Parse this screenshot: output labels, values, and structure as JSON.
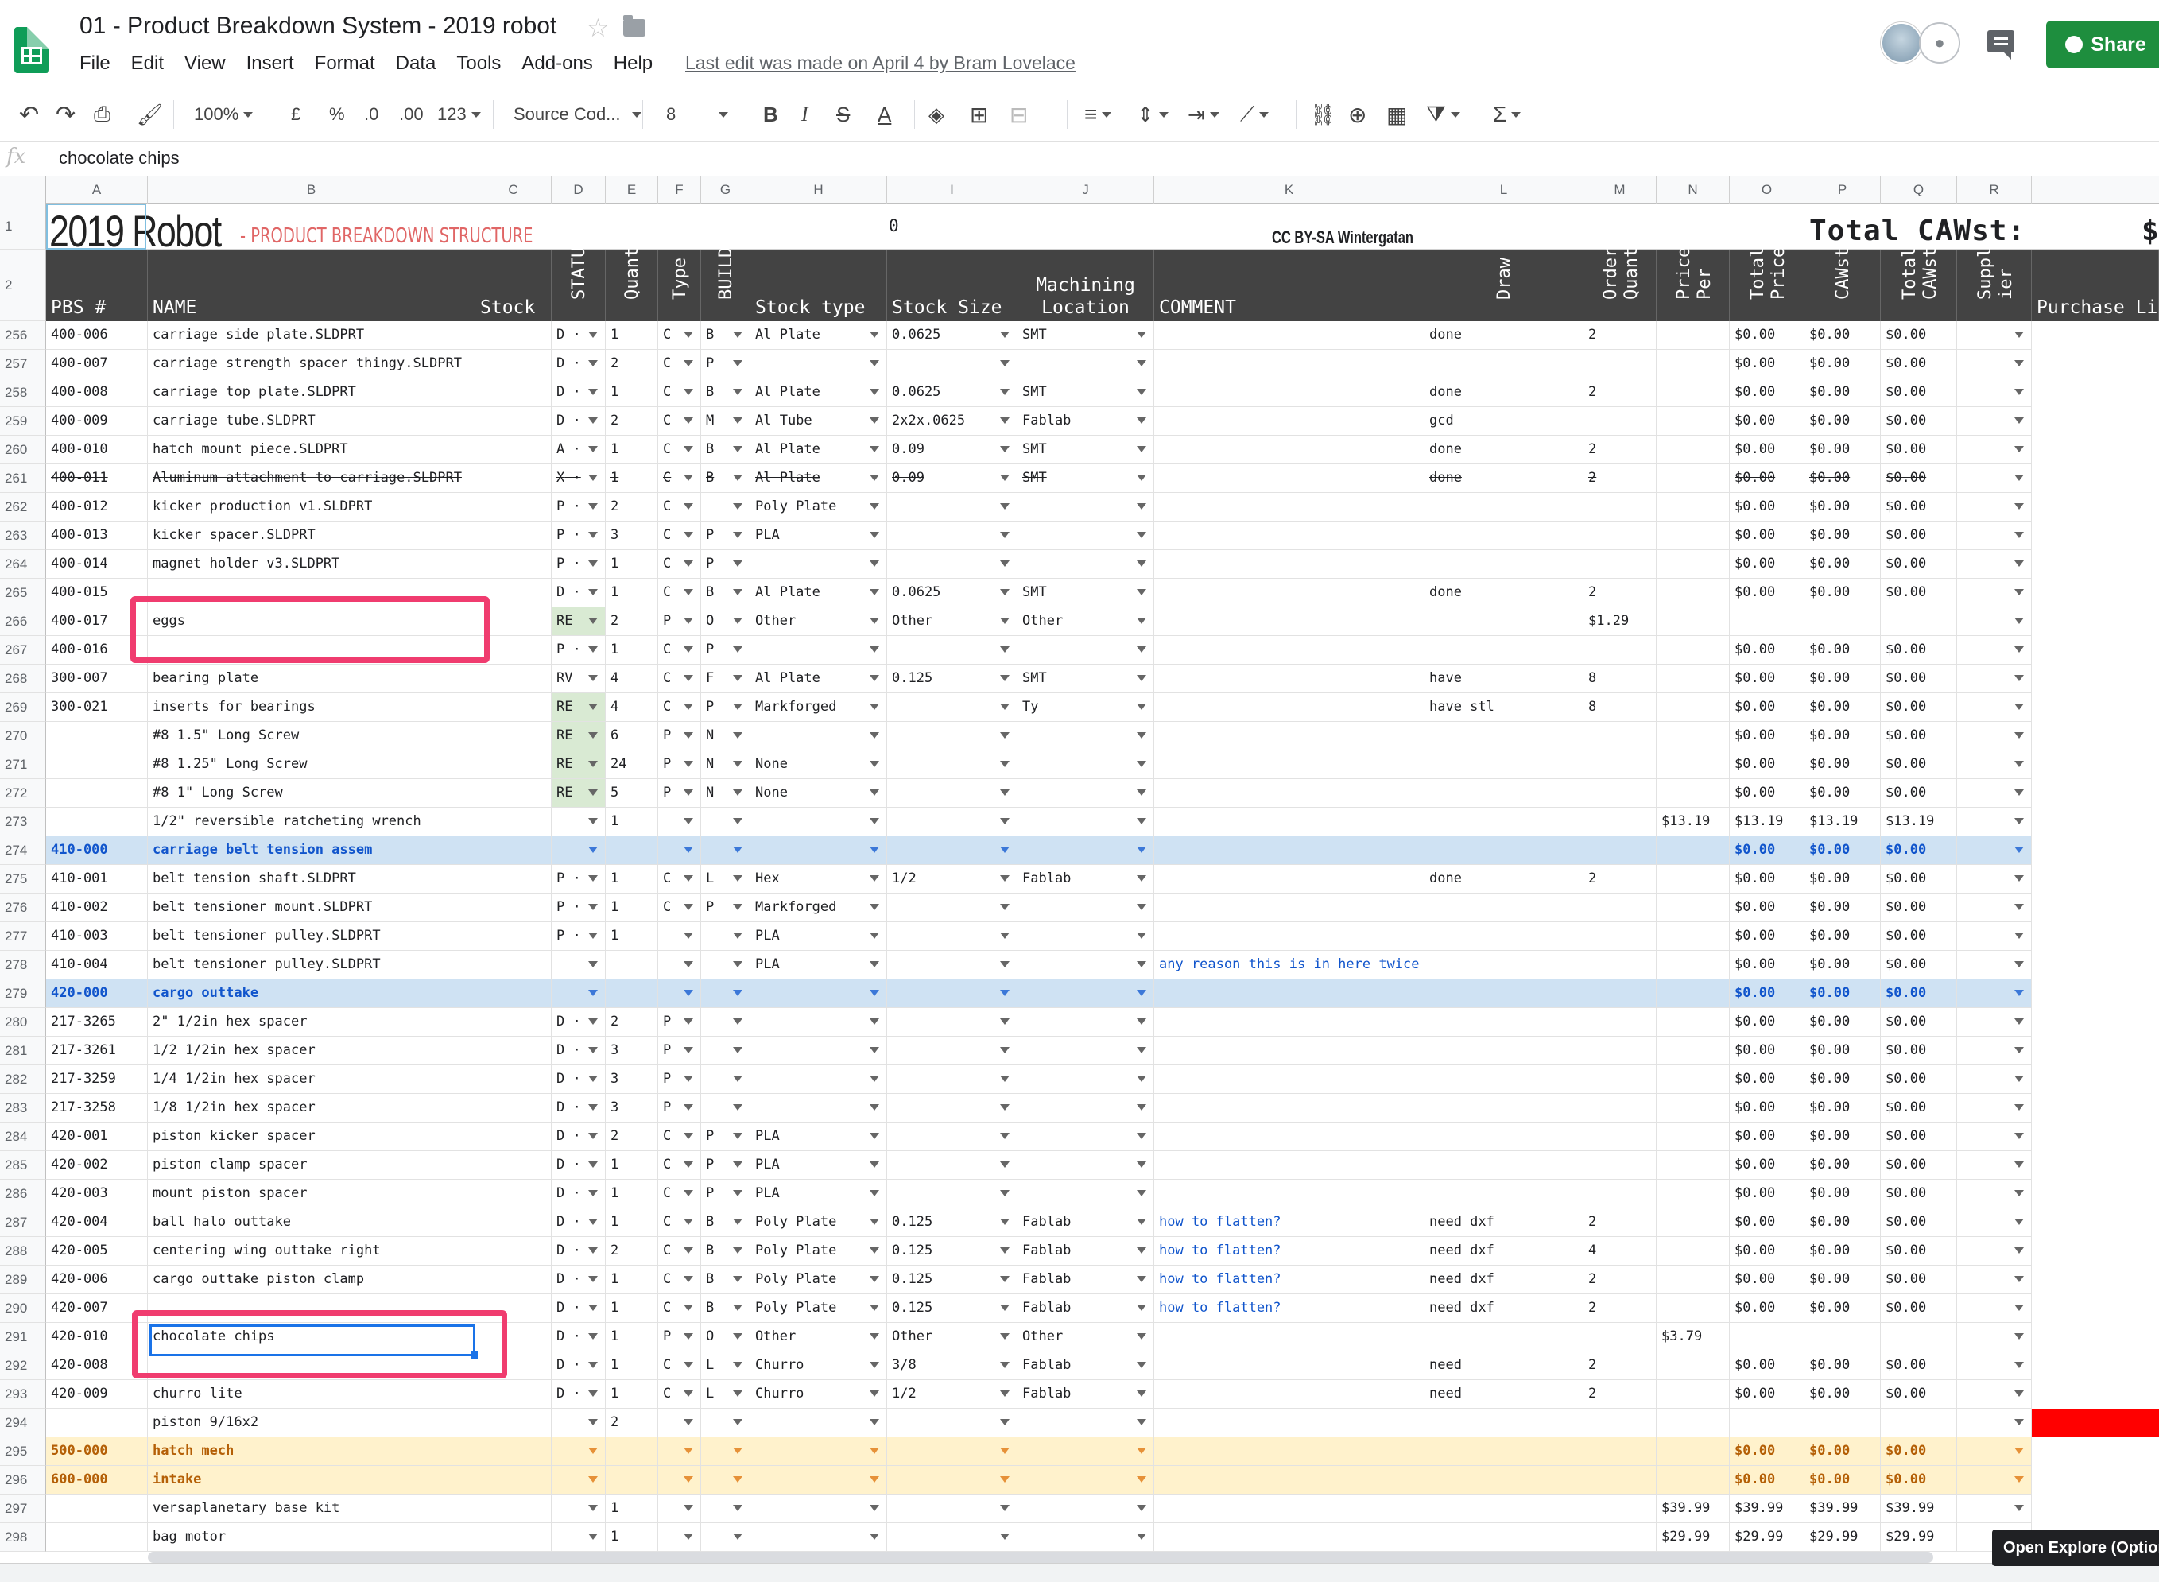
{
  "doc": {
    "title": "01 - Product Breakdown System - 2019 robot",
    "last_edit": "Last edit was made on April 4 by Bram Lovelace",
    "share_label": "Share"
  },
  "menu": [
    "File",
    "Edit",
    "View",
    "Insert",
    "Format",
    "Data",
    "Tools",
    "Add-ons",
    "Help"
  ],
  "toolbar": {
    "zoom": "100%",
    "currency": "£",
    "percent": "%",
    "dec_less": ".0",
    "dec_more": ".00",
    "format_more": "123",
    "font": "Source Cod...",
    "font_size": "8"
  },
  "formula": {
    "value": "chocolate chips"
  },
  "columns": [
    "A",
    "B",
    "C",
    "D",
    "E",
    "F",
    "G",
    "H",
    "I",
    "J",
    "K",
    "L",
    "M",
    "N",
    "O",
    "P",
    "Q",
    "R"
  ],
  "header_row1": {
    "row": "1",
    "title_big": "2019 Robot",
    "title_sub": "- PRODUCT BREAKDOWN STRUCTURE",
    "zero": "0",
    "cc": "CC BY-SA Wintergatan",
    "total": "Total CAWst:",
    "dollar": "$"
  },
  "header_row2": {
    "row": "2",
    "pbs": "PBS #",
    "name": "NAME",
    "stock": "Stock",
    "status": "STATUS",
    "quant": "Quant",
    "type": "Type",
    "build": "BUILD",
    "stock_type": "Stock type",
    "stock_size": "Stock Size",
    "machining": "Machining",
    "location": "Location",
    "comment": "COMMENT",
    "draw": "Draw",
    "order_quant_1": "Order",
    "order_quant_2": "Quant",
    "price_per_1": "Price",
    "price_per_2": "Per",
    "total_price_1": "Total",
    "total_price_2": "Price",
    "cawst": "CAWst",
    "total_cawst_1": "Total",
    "total_cawst_2": "CAWst",
    "supplier_1": "Suppl",
    "supplier_2": "ier",
    "purchase": "Purchase Li"
  },
  "rows": [
    {
      "n": "256",
      "a": "400-006",
      "b": "carriage side plate.SLDPRT",
      "d": "D",
      "e": "1",
      "f": "C",
      "g": "B",
      "h": "Al Plate",
      "i": "0.0625",
      "j": "SMT",
      "k": "",
      "l": "done",
      "m": "2",
      "nn": "",
      "o": "$0.00",
      "p": "$0.00",
      "q": "$0.00"
    },
    {
      "n": "257",
      "a": "400-007",
      "b": "carriage strength spacer thingy.SLDPRT",
      "d": "D",
      "e": "2",
      "f": "C",
      "g": "P",
      "h": "",
      "i": "",
      "j": "",
      "k": "",
      "l": "",
      "m": "",
      "nn": "",
      "o": "$0.00",
      "p": "$0.00",
      "q": "$0.00"
    },
    {
      "n": "258",
      "a": "400-008",
      "b": "carriage top plate.SLDPRT",
      "d": "D",
      "e": "1",
      "f": "C",
      "g": "B",
      "h": "Al Plate",
      "i": "0.0625",
      "j": "SMT",
      "k": "",
      "l": "done",
      "m": "2",
      "nn": "",
      "o": "$0.00",
      "p": "$0.00",
      "q": "$0.00"
    },
    {
      "n": "259",
      "a": "400-009",
      "b": "carriage tube.SLDPRT",
      "d": "D",
      "e": "2",
      "f": "C",
      "g": "M",
      "h": "Al Tube",
      "i": "2x2x.0625",
      "j": "Fablab",
      "k": "",
      "l": "gcd",
      "m": "",
      "nn": "",
      "o": "$0.00",
      "p": "$0.00",
      "q": "$0.00"
    },
    {
      "n": "260",
      "a": "400-010",
      "b": "hatch mount piece.SLDPRT",
      "d": "A",
      "e": "1",
      "f": "C",
      "g": "B",
      "h": "Al Plate",
      "i": "0.09",
      "j": "SMT",
      "k": "",
      "l": "done",
      "m": "2",
      "nn": "",
      "o": "$0.00",
      "p": "$0.00",
      "q": "$0.00"
    },
    {
      "n": "261",
      "a": "400-011",
      "b": "Aluminum attachment to carriage.SLDPRT",
      "d": "X",
      "e": "1",
      "f": "C",
      "g": "B",
      "h": "Al Plate",
      "i": "0.09",
      "j": "SMT",
      "k": "",
      "l": "done",
      "m": "2",
      "nn": "",
      "o": "$0.00",
      "p": "$0.00",
      "q": "$0.00",
      "strike": true
    },
    {
      "n": "262",
      "a": "400-012",
      "b": "kicker production v1.SLDPRT",
      "d": "P",
      "e": "2",
      "f": "C",
      "g": "",
      "h": "Poly Plate",
      "i": "",
      "j": "",
      "k": "",
      "l": "",
      "m": "",
      "nn": "",
      "o": "$0.00",
      "p": "$0.00",
      "q": "$0.00"
    },
    {
      "n": "263",
      "a": "400-013",
      "b": "kicker spacer.SLDPRT",
      "d": "P",
      "e": "3",
      "f": "C",
      "g": "P",
      "h": "PLA",
      "i": "",
      "j": "",
      "k": "",
      "l": "",
      "m": "",
      "nn": "",
      "o": "$0.00",
      "p": "$0.00",
      "q": "$0.00"
    },
    {
      "n": "264",
      "a": "400-014",
      "b": "magnet holder v3.SLDPRT",
      "d": "P",
      "e": "1",
      "f": "C",
      "g": "P",
      "h": "",
      "i": "",
      "j": "",
      "k": "",
      "l": "",
      "m": "",
      "nn": "",
      "o": "$0.00",
      "p": "$0.00",
      "q": "$0.00"
    },
    {
      "n": "265",
      "a": "400-015",
      "b": "",
      "d": "D",
      "e": "1",
      "f": "C",
      "g": "B",
      "h": "Al Plate",
      "i": "0.0625",
      "j": "SMT",
      "k": "",
      "l": "done",
      "m": "2",
      "nn": "",
      "o": "$0.00",
      "p": "$0.00",
      "q": "$0.00"
    },
    {
      "n": "266",
      "a": "400-017",
      "b": "eggs",
      "d": "RE",
      "e": "2",
      "f": "P",
      "g": "O",
      "h": "Other",
      "i": "Other",
      "j": "Other",
      "k": "",
      "l": "",
      "m": "$1.29",
      "nn": "",
      "o": "",
      "p": "",
      "q": ""
    },
    {
      "n": "267",
      "a": "400-016",
      "b": "",
      "d": "P",
      "e": "1",
      "f": "C",
      "g": "P",
      "h": "",
      "i": "",
      "j": "",
      "k": "",
      "l": "",
      "m": "",
      "nn": "",
      "o": "$0.00",
      "p": "$0.00",
      "q": "$0.00"
    },
    {
      "n": "268",
      "a": "300-007",
      "b": "bearing plate",
      "d": "RV",
      "e": "4",
      "f": "C",
      "g": "F",
      "h": "Al Plate",
      "i": "0.125",
      "j": "SMT",
      "k": "",
      "l": "have",
      "m": "8",
      "nn": "",
      "o": "$0.00",
      "p": "$0.00",
      "q": "$0.00"
    },
    {
      "n": "269",
      "a": "300-021",
      "b": "inserts for bearings",
      "d": "RE",
      "e": "4",
      "f": "C",
      "g": "P",
      "h": "Markforged",
      "i": "",
      "j": "Ty",
      "k": "",
      "l": "have stl",
      "m": "8",
      "nn": "",
      "o": "$0.00",
      "p": "$0.00",
      "q": "$0.00"
    },
    {
      "n": "270",
      "a": "",
      "b": "#8 1.5\" Long Screw",
      "d": "RE",
      "e": "6",
      "f": "P",
      "g": "N",
      "h": "",
      "i": "",
      "j": "",
      "k": "",
      "l": "",
      "m": "",
      "nn": "",
      "o": "$0.00",
      "p": "$0.00",
      "q": "$0.00"
    },
    {
      "n": "271",
      "a": "",
      "b": "#8 1.25\" Long Screw",
      "d": "RE",
      "e": "24",
      "f": "P",
      "g": "N",
      "h": "None",
      "i": "",
      "j": "",
      "k": "",
      "l": "",
      "m": "",
      "nn": "",
      "o": "$0.00",
      "p": "$0.00",
      "q": "$0.00"
    },
    {
      "n": "272",
      "a": "",
      "b": "#8 1\" Long Screw",
      "d": "RE",
      "e": "5",
      "f": "P",
      "g": "N",
      "h": "None",
      "i": "",
      "j": "",
      "k": "",
      "l": "",
      "m": "",
      "nn": "",
      "o": "$0.00",
      "p": "$0.00",
      "q": "$0.00"
    },
    {
      "n": "273",
      "a": "",
      "b": "1/2\" reversible ratcheting wrench",
      "d": "",
      "e": "1",
      "f": "",
      "g": "",
      "h": "",
      "i": "",
      "j": "",
      "k": "",
      "l": "",
      "m": "",
      "nn": "$13.19",
      "o": "$13.19",
      "p": "$13.19",
      "q": "$13.19"
    },
    {
      "n": "274",
      "a": "410-000",
      "b": "carriage belt tension assem",
      "d": "",
      "e": "",
      "f": "",
      "g": "",
      "h": "",
      "i": "",
      "j": "",
      "k": "",
      "l": "",
      "m": "",
      "nn": "",
      "o": "$0.00",
      "p": "$0.00",
      "q": "$0.00",
      "band": "blue"
    },
    {
      "n": "275",
      "a": "410-001",
      "b": "belt tension shaft.SLDPRT",
      "d": "P",
      "e": "1",
      "f": "C",
      "g": "L",
      "h": "Hex",
      "i": "1/2",
      "j": "Fablab",
      "k": "",
      "l": "done",
      "m": "2",
      "nn": "",
      "o": "$0.00",
      "p": "$0.00",
      "q": "$0.00"
    },
    {
      "n": "276",
      "a": "410-002",
      "b": "belt tensioner mount.SLDPRT",
      "d": "P",
      "e": "1",
      "f": "C",
      "g": "P",
      "h": "Markforged",
      "i": "",
      "j": "",
      "k": "",
      "l": "",
      "m": "",
      "nn": "",
      "o": "$0.00",
      "p": "$0.00",
      "q": "$0.00"
    },
    {
      "n": "277",
      "a": "410-003",
      "b": "belt tensioner pulley.SLDPRT",
      "d": "P",
      "e": "1",
      "f": "",
      "g": "",
      "h": "PLA",
      "i": "",
      "j": "",
      "k": "",
      "l": "",
      "m": "",
      "nn": "",
      "o": "$0.00",
      "p": "$0.00",
      "q": "$0.00"
    },
    {
      "n": "278",
      "a": "410-004",
      "b": "belt tensioner pulley.SLDPRT",
      "d": "",
      "e": "",
      "f": "",
      "g": "",
      "h": "PLA",
      "i": "",
      "j": "",
      "k": "any reason this is in here twice",
      "l": "",
      "m": "",
      "nn": "",
      "o": "$0.00",
      "p": "$0.00",
      "q": "$0.00"
    },
    {
      "n": "279",
      "a": "420-000",
      "b": "cargo outtake",
      "d": "",
      "e": "",
      "f": "",
      "g": "",
      "h": "",
      "i": "",
      "j": "",
      "k": "",
      "l": "",
      "m": "",
      "nn": "",
      "o": "$0.00",
      "p": "$0.00",
      "q": "$0.00",
      "band": "blue"
    },
    {
      "n": "280",
      "a": "217-3265",
      "b": "2\" 1/2in hex spacer",
      "d": "D",
      "e": "2",
      "f": "P",
      "g": "",
      "h": "",
      "i": "",
      "j": "",
      "k": "",
      "l": "",
      "m": "",
      "nn": "",
      "o": "$0.00",
      "p": "$0.00",
      "q": "$0.00"
    },
    {
      "n": "281",
      "a": "217-3261",
      "b": "1/2 1/2in hex spacer",
      "d": "D",
      "e": "3",
      "f": "P",
      "g": "",
      "h": "",
      "i": "",
      "j": "",
      "k": "",
      "l": "",
      "m": "",
      "nn": "",
      "o": "$0.00",
      "p": "$0.00",
      "q": "$0.00"
    },
    {
      "n": "282",
      "a": "217-3259",
      "b": "1/4 1/2in hex spacer",
      "d": "D",
      "e": "3",
      "f": "P",
      "g": "",
      "h": "",
      "i": "",
      "j": "",
      "k": "",
      "l": "",
      "m": "",
      "nn": "",
      "o": "$0.00",
      "p": "$0.00",
      "q": "$0.00"
    },
    {
      "n": "283",
      "a": "217-3258",
      "b": "1/8 1/2in hex spacer",
      "d": "D",
      "e": "3",
      "f": "P",
      "g": "",
      "h": "",
      "i": "",
      "j": "",
      "k": "",
      "l": "",
      "m": "",
      "nn": "",
      "o": "$0.00",
      "p": "$0.00",
      "q": "$0.00"
    },
    {
      "n": "284",
      "a": "420-001",
      "b": "piston kicker spacer",
      "d": "D",
      "e": "2",
      "f": "C",
      "g": "P",
      "h": "PLA",
      "i": "",
      "j": "",
      "k": "",
      "l": "",
      "m": "",
      "nn": "",
      "o": "$0.00",
      "p": "$0.00",
      "q": "$0.00"
    },
    {
      "n": "285",
      "a": "420-002",
      "b": "piston clamp spacer",
      "d": "D",
      "e": "1",
      "f": "C",
      "g": "P",
      "h": "PLA",
      "i": "",
      "j": "",
      "k": "",
      "l": "",
      "m": "",
      "nn": "",
      "o": "$0.00",
      "p": "$0.00",
      "q": "$0.00"
    },
    {
      "n": "286",
      "a": "420-003",
      "b": "mount piston spacer",
      "d": "D",
      "e": "1",
      "f": "C",
      "g": "P",
      "h": "PLA",
      "i": "",
      "j": "",
      "k": "",
      "l": "",
      "m": "",
      "nn": "",
      "o": "$0.00",
      "p": "$0.00",
      "q": "$0.00"
    },
    {
      "n": "287",
      "a": "420-004",
      "b": "ball halo outtake",
      "d": "D",
      "e": "1",
      "f": "C",
      "g": "B",
      "h": "Poly Plate",
      "i": "0.125",
      "j": "Fablab",
      "k": "how to flatten?",
      "l": "need dxf",
      "m": "2",
      "nn": "",
      "o": "$0.00",
      "p": "$0.00",
      "q": "$0.00"
    },
    {
      "n": "288",
      "a": "420-005",
      "b": "centering wing outtake right",
      "d": "D",
      "e": "2",
      "f": "C",
      "g": "B",
      "h": "Poly Plate",
      "i": "0.125",
      "j": "Fablab",
      "k": "how to flatten?",
      "l": "need dxf",
      "m": "4",
      "nn": "",
      "o": "$0.00",
      "p": "$0.00",
      "q": "$0.00"
    },
    {
      "n": "289",
      "a": "420-006",
      "b": "cargo outtake piston clamp",
      "d": "D",
      "e": "1",
      "f": "C",
      "g": "B",
      "h": "Poly Plate",
      "i": "0.125",
      "j": "Fablab",
      "k": "how to flatten?",
      "l": "need dxf",
      "m": "2",
      "nn": "",
      "o": "$0.00",
      "p": "$0.00",
      "q": "$0.00"
    },
    {
      "n": "290",
      "a": "420-007",
      "b": "",
      "d": "D",
      "e": "1",
      "f": "C",
      "g": "B",
      "h": "Poly Plate",
      "i": "0.125",
      "j": "Fablab",
      "k": "how to flatten?",
      "l": "need dxf",
      "m": "2",
      "nn": "",
      "o": "$0.00",
      "p": "$0.00",
      "q": "$0.00"
    },
    {
      "n": "291",
      "a": "420-010",
      "b": "chocolate chips",
      "d": "D",
      "e": "1",
      "f": "P",
      "g": "O",
      "h": "Other",
      "i": "Other",
      "j": "Other",
      "k": "",
      "l": "",
      "m": "",
      "nn": "$3.79",
      "o": "",
      "p": "",
      "q": ""
    },
    {
      "n": "292",
      "a": "420-008",
      "b": "",
      "d": "D",
      "e": "1",
      "f": "C",
      "g": "L",
      "h": "Churro",
      "i": "3/8",
      "j": "Fablab",
      "k": "",
      "l": "need",
      "m": "2",
      "nn": "",
      "o": "$0.00",
      "p": "$0.00",
      "q": "$0.00"
    },
    {
      "n": "293",
      "a": "420-009",
      "b": "churro lite",
      "d": "D",
      "e": "1",
      "f": "C",
      "g": "L",
      "h": "Churro",
      "i": "1/2",
      "j": "Fablab",
      "k": "",
      "l": "need",
      "m": "2",
      "nn": "",
      "o": "$0.00",
      "p": "$0.00",
      "q": "$0.00"
    },
    {
      "n": "294",
      "a": "",
      "b": "piston 9/16x2",
      "d": "",
      "e": "2",
      "f": "",
      "g": "",
      "h": "",
      "i": "",
      "j": "",
      "k": "",
      "l": "",
      "m": "",
      "nn": "",
      "o": "",
      "p": "",
      "q": "",
      "redtail": true
    },
    {
      "n": "295",
      "a": "500-000",
      "b": "hatch mech",
      "d": "",
      "e": "",
      "f": "",
      "g": "",
      "h": "",
      "i": "",
      "j": "",
      "k": "",
      "l": "",
      "m": "",
      "nn": "",
      "o": "$0.00",
      "p": "$0.00",
      "q": "$0.00",
      "band": "yellow"
    },
    {
      "n": "296",
      "a": "600-000",
      "b": "intake",
      "d": "",
      "e": "",
      "f": "",
      "g": "",
      "h": "",
      "i": "",
      "j": "",
      "k": "",
      "l": "",
      "m": "",
      "nn": "",
      "o": "$0.00",
      "p": "$0.00",
      "q": "$0.00",
      "band": "yellow"
    },
    {
      "n": "297",
      "a": "",
      "b": "versaplanetary base kit",
      "d": "",
      "e": "1",
      "f": "",
      "g": "",
      "h": "",
      "i": "",
      "j": "",
      "k": "",
      "l": "",
      "m": "",
      "nn": "$39.99",
      "o": "$39.99",
      "p": "$39.99",
      "q": "$39.99"
    },
    {
      "n": "298",
      "a": "",
      "b": "bag motor",
      "d": "",
      "e": "1",
      "f": "",
      "g": "",
      "h": "",
      "i": "",
      "j": "",
      "k": "",
      "l": "",
      "m": "",
      "nn": "$29.99",
      "o": "$29.99",
      "p": "$29.99",
      "q": "$29.99"
    }
  ],
  "explore_label": "Open Explore (Option+",
  "colors": {
    "re_green": "#d9ead3",
    "band_blue": "#cfe2f3",
    "band_blue_text": "#1155cc",
    "band_yellow": "#fff2cc",
    "band_yellow_text": "#b45f06",
    "highlight_pink": "#f03c6f",
    "header_dark": "#434343",
    "red_fill": "#ff0000"
  }
}
